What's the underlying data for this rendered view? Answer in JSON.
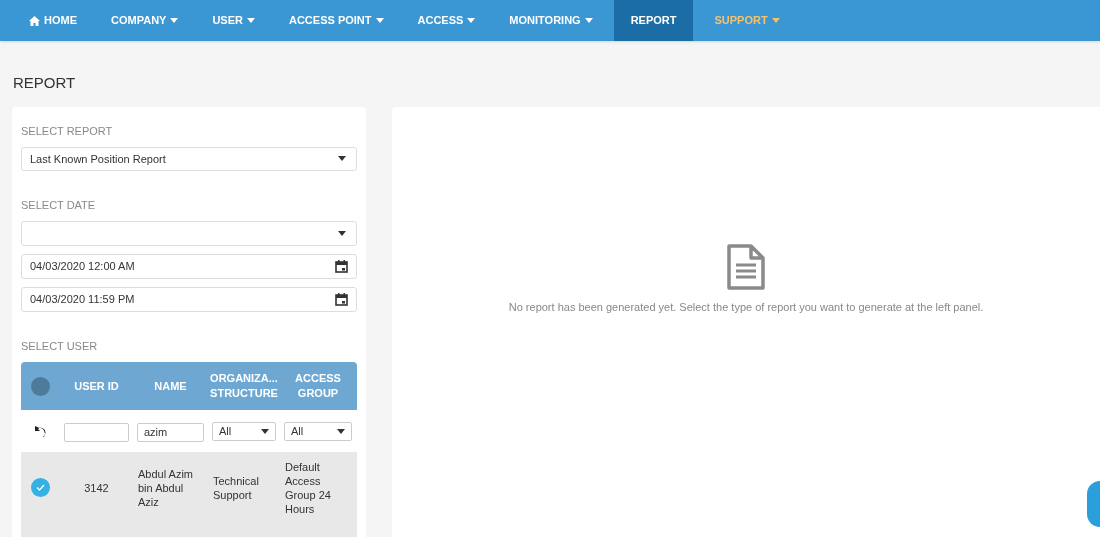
{
  "nav": [
    {
      "label": "HOME",
      "dropdown": false,
      "selected": false,
      "color": "#ffffff"
    },
    {
      "label": "COMPANY",
      "dropdown": true,
      "selected": false,
      "color": "#ffffff"
    },
    {
      "label": "USER",
      "dropdown": true,
      "selected": false,
      "color": "#ffffff"
    },
    {
      "label": "ACCESS POINT",
      "dropdown": true,
      "selected": false,
      "color": "#ffffff"
    },
    {
      "label": "ACCESS",
      "dropdown": true,
      "selected": false,
      "color": "#ffffff"
    },
    {
      "label": "MONITORING",
      "dropdown": true,
      "selected": false,
      "color": "#ffffff"
    },
    {
      "label": "REPORT",
      "dropdown": false,
      "selected": true,
      "color": "#ffffff"
    },
    {
      "label": "SUPPORT",
      "dropdown": true,
      "selected": false,
      "color": "#f5c26b"
    }
  ],
  "page_title": "REPORT",
  "left_panel": {
    "report_label": "SELECT REPORT",
    "report_select": {
      "value": "Last Known Position Report"
    },
    "date_label": "SELECT DATE",
    "start_date": {
      "value": "04/03/2020 12:00 AM"
    },
    "end_date": {
      "value": "04/03/2020 11:59 PM"
    },
    "user_label": "SELECT USER",
    "table": {
      "select_all_checked": false,
      "columns": [
        "USER ID",
        "NAME",
        "ORGANIZA...\nSTRUCTURE",
        "ACCESS\nGROUP"
      ],
      "filters": [
        {
          "kind": "text"
        },
        {
          "kind": "text",
          "value": "azim"
        },
        {
          "kind": "select",
          "value": "All"
        },
        {
          "kind": "select",
          "value": "All"
        }
      ],
      "rows": [
        {
          "checked": true,
          "cells": [
            "3142",
            "Abdul Azim bin Abdul Aziz",
            "Technical Support",
            "Default Access Group 24 Hours"
          ]
        }
      ]
    }
  },
  "report_area": {
    "message": "No report has been generated yet. Select the type of report you want to generate at the left panel."
  }
}
